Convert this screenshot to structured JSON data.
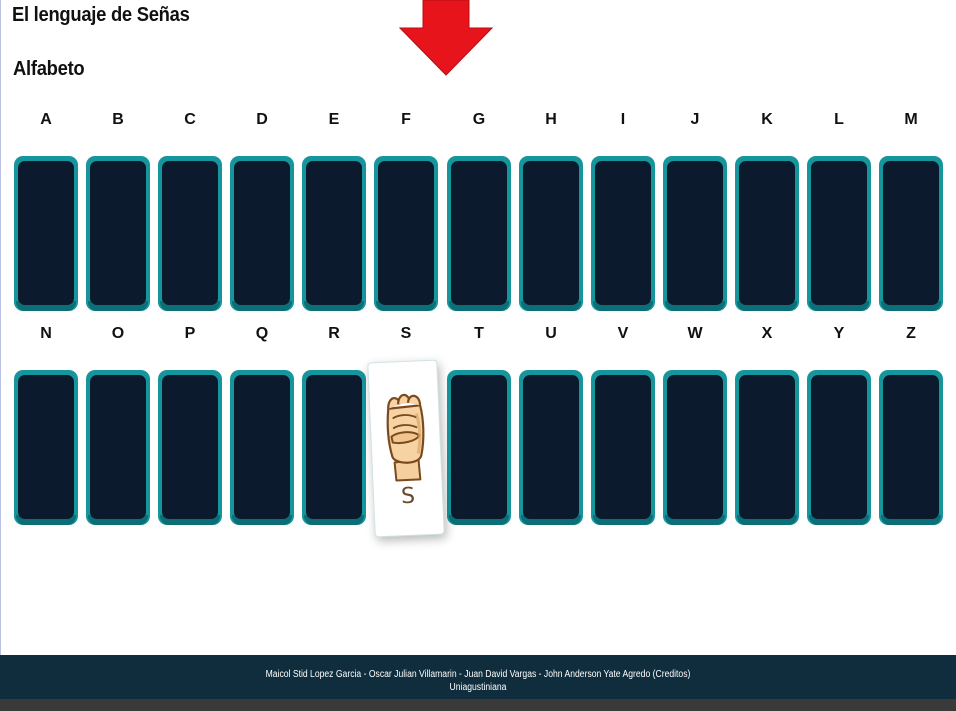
{
  "page": {
    "title": "El lenguaje de Señas",
    "section_title": "Alfabeto"
  },
  "alphabet": {
    "row1": [
      "A",
      "B",
      "C",
      "D",
      "E",
      "F",
      "G",
      "H",
      "I",
      "J",
      "K",
      "L",
      "M"
    ],
    "row2": [
      "N",
      "O",
      "P",
      "Q",
      "R",
      "S",
      "T",
      "U",
      "V",
      "W",
      "X",
      "Y",
      "Z"
    ],
    "flipped_card_letter": "S",
    "flipped_card_icon": "fist-hand-sign-icon"
  },
  "footer": {
    "credits": "Maicol Stid Lopez Garcia - Oscar Julian Villamarin - Juan David Vargas - John Anderson Yate Agredo (Creditos)",
    "institution": "Uniagustiniana"
  },
  "colors": {
    "arrow": "#e8141b",
    "card_border": "#17959c",
    "card_face": "#0c1a2d",
    "footer_bg": "#0f2d3c"
  },
  "icons": {
    "arrow": "red-down-arrow-icon"
  }
}
